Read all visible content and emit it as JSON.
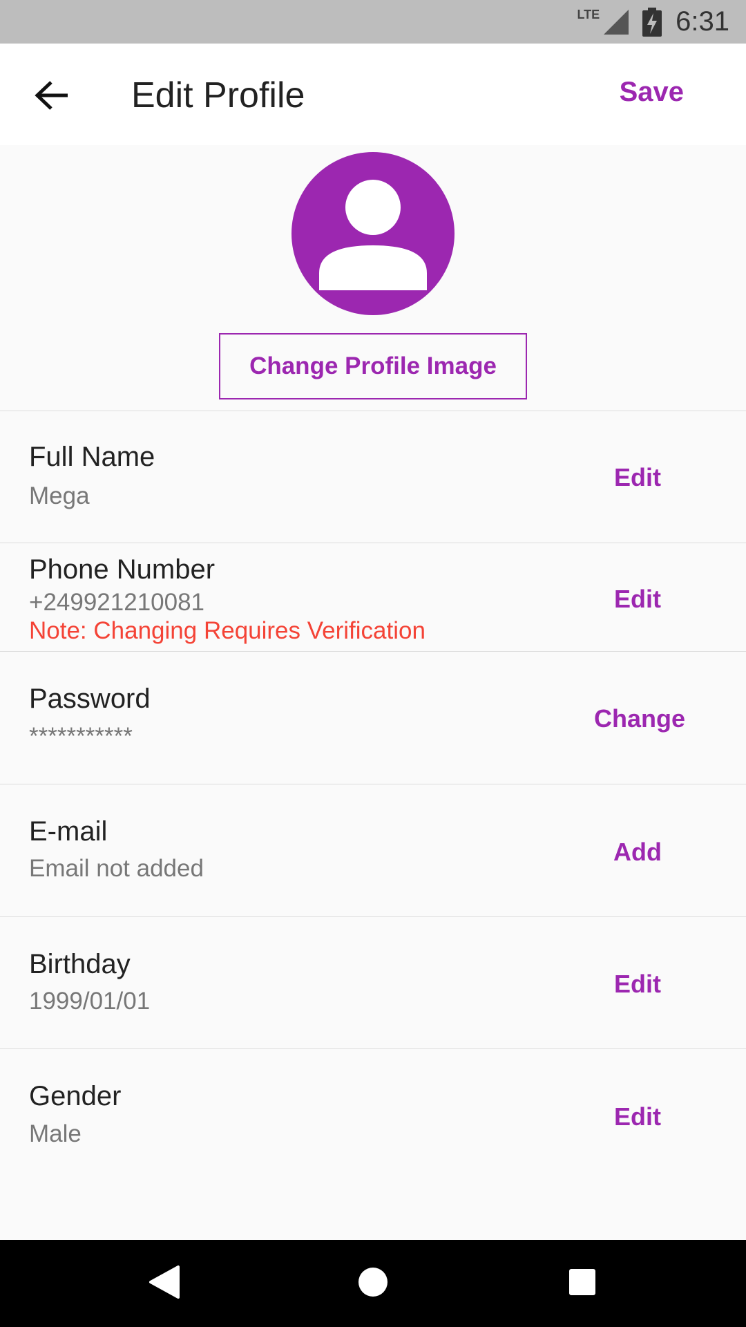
{
  "status_bar": {
    "network": "LTE",
    "time": "6:31"
  },
  "app_bar": {
    "title": "Edit Profile",
    "save_label": "Save"
  },
  "profile": {
    "change_image_label": "Change Profile Image"
  },
  "fields": [
    {
      "label": "Full Name",
      "value": "Mega",
      "action": "Edit"
    },
    {
      "label": "Phone Number",
      "value": "+249921210081",
      "note": "Note: Changing Requires Verification",
      "action": "Edit"
    },
    {
      "label": "Password",
      "value": "***********",
      "action": "Change"
    },
    {
      "label": "E-mail",
      "value": "Email not added",
      "action": "Add"
    },
    {
      "label": "Birthday",
      "value": "1999/01/01",
      "action": "Edit"
    },
    {
      "label": "Gender",
      "value": "Male",
      "action": "Edit"
    }
  ],
  "colors": {
    "accent": "#9c27b0",
    "warning": "#f44336",
    "status_bar": "#bdbdbd",
    "nav_bar": "#000000"
  },
  "icons": {
    "back": "arrow-left-icon",
    "avatar": "person-icon",
    "signal": "signal-icon",
    "battery": "battery-charging-icon",
    "nav_back": "triangle-back-icon",
    "nav_home": "circle-home-icon",
    "nav_recents": "square-recents-icon"
  }
}
